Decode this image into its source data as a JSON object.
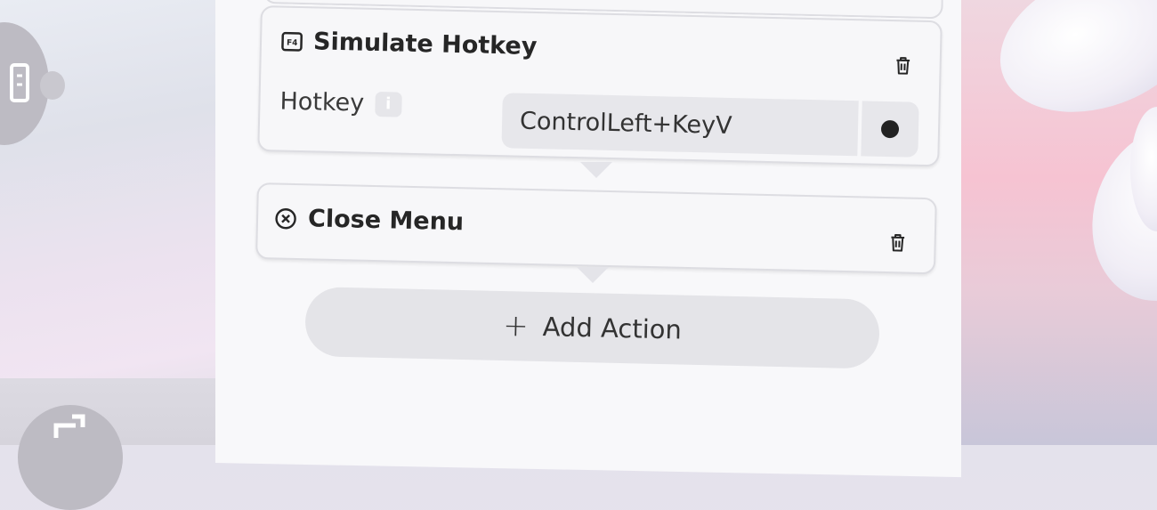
{
  "cards": {
    "simulate_hotkey": {
      "title": "Simulate Hotkey",
      "icon": "function-key-icon",
      "hotkey_label": "Hotkey",
      "hotkey_value": "ControlLeft+KeyV",
      "info_glyph": "i"
    },
    "close_menu": {
      "title": "Close Menu",
      "icon": "close-circle-icon"
    }
  },
  "add_action": {
    "plus": "+",
    "label": "Add Action"
  },
  "colors": {
    "panel": "#f8f8fa",
    "card_border": "#dddde2",
    "field_bg": "#e7e7eb",
    "text": "#262626"
  }
}
